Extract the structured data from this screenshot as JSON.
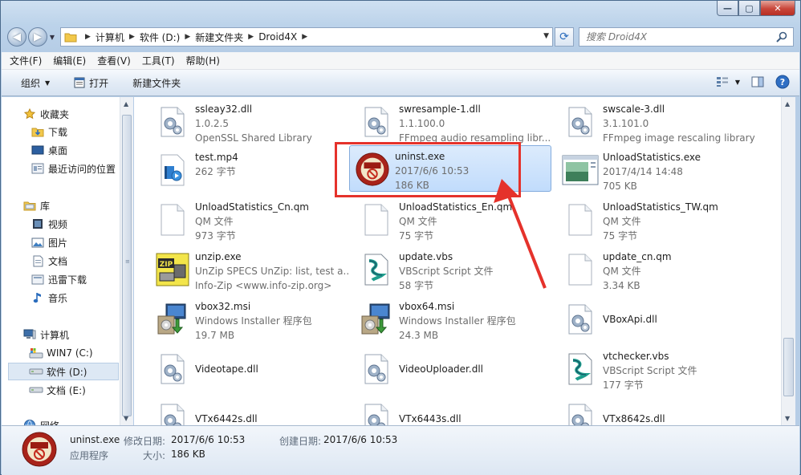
{
  "window": {
    "caption_buttons": {
      "minimize": "—",
      "maximize": "▢",
      "close": "✕"
    }
  },
  "nav": {
    "breadcrumbs": [
      "计算机",
      "软件 (D:)",
      "新建文件夹",
      "Droid4X"
    ],
    "search_placeholder": "搜索 Droid4X"
  },
  "menu": {
    "items": [
      "文件(F)",
      "编辑(E)",
      "查看(V)",
      "工具(T)",
      "帮助(H)"
    ]
  },
  "toolbar": {
    "organize": "组织",
    "open": "打开",
    "new_folder": "新建文件夹"
  },
  "sidebar": {
    "favorites": "收藏夹",
    "downloads": "下载",
    "desktop": "桌面",
    "recent": "最近访问的位置",
    "libraries": "库",
    "videos": "视频",
    "pictures": "图片",
    "documents": "文档",
    "xunlei": "迅雷下载",
    "music": "音乐",
    "computer": "计算机",
    "drive_c": "WIN7 (C:)",
    "drive_d": "软件 (D:)",
    "drive_e": "文档 (E:)",
    "network": "网络"
  },
  "files": [
    {
      "name": "ssleay32.dll",
      "line2": "1.0.2.5",
      "line3": "OpenSSL Shared Library",
      "icon": "dll-gear-icon"
    },
    {
      "name": "swresample-1.dll",
      "line2": "1.1.100.0",
      "line3": "FFmpeg audio resampling libr...",
      "icon": "dll-gear-icon"
    },
    {
      "name": "swscale-3.dll",
      "line2": "3.1.101.0",
      "line3": "FFmpeg image rescaling library",
      "icon": "dll-gear-icon"
    },
    {
      "name": "test.mp4",
      "line2": "262 字节",
      "line3": "",
      "icon": "video-file-icon"
    },
    {
      "name": "uninst.exe",
      "line2": "2017/6/6 10:53",
      "line3": "186 KB",
      "icon": "nsis-uninstaller-icon"
    },
    {
      "name": "UnloadStatistics.exe",
      "line2": "2017/4/14 14:48",
      "line3": "705 KB",
      "icon": "app-window-icon"
    },
    {
      "name": "UnloadStatistics_Cn.qm",
      "line2": "QM 文件",
      "line3": "973 字节",
      "icon": "blank-file-icon"
    },
    {
      "name": "UnloadStatistics_En.qm",
      "line2": "QM 文件",
      "line3": "75 字节",
      "icon": "blank-file-icon"
    },
    {
      "name": "UnloadStatistics_TW.qm",
      "line2": "QM 文件",
      "line3": "75 字节",
      "icon": "blank-file-icon"
    },
    {
      "name": "unzip.exe",
      "line2": "UnZip SPECS UnZip: list, test a...",
      "line3": "Info-Zip <www.info-zip.org>",
      "icon": "zip-clamp-icon"
    },
    {
      "name": "update.vbs",
      "line2": "VBScript Script 文件",
      "line3": "58 字节",
      "icon": "vbs-script-icon"
    },
    {
      "name": "update_cn.qm",
      "line2": "QM 文件",
      "line3": "3.34 KB",
      "icon": "blank-file-icon"
    },
    {
      "name": "vbox32.msi",
      "line2": "Windows Installer 程序包",
      "line3": "19.7 MB",
      "icon": "msi-installer-icon"
    },
    {
      "name": "vbox64.msi",
      "line2": "Windows Installer 程序包",
      "line3": "24.3 MB",
      "icon": "msi-installer-icon"
    },
    {
      "name": "VBoxApi.dll",
      "line2": "",
      "line3": "",
      "icon": "dll-gear-icon"
    },
    {
      "name": "Videotape.dll",
      "line2": "",
      "line3": "",
      "icon": "dll-gear-icon"
    },
    {
      "name": "VideoUploader.dll",
      "line2": "",
      "line3": "",
      "icon": "dll-gear-icon"
    },
    {
      "name": "vtchecker.vbs",
      "line2": "VBScript Script 文件",
      "line3": "177 字节",
      "icon": "vbs-script-icon"
    },
    {
      "name": "VTx6442s.dll",
      "line2": "",
      "line3": "",
      "icon": "dll-gear-icon"
    },
    {
      "name": "VTx6443s.dll",
      "line2": "",
      "line3": "",
      "icon": "dll-gear-icon"
    },
    {
      "name": "VTx8642s.dll",
      "line2": "",
      "line3": "",
      "icon": "dll-gear-icon"
    }
  ],
  "details": {
    "name": "uninst.exe",
    "type": "应用程序",
    "modified_label": "修改日期:",
    "modified_value": "2017/6/6 10:53",
    "created_label": "创建日期:",
    "created_value": "2017/6/6 10:53",
    "size_label": "大小:",
    "size_value": "186 KB"
  },
  "colors": {
    "highlight": "#e5322b",
    "selection": "#c1dcfc"
  }
}
